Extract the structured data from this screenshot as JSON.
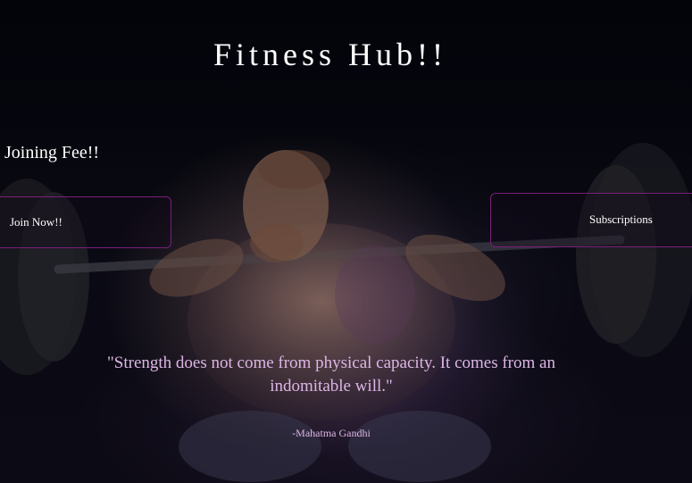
{
  "header": {
    "title": "Fitness Hub!!"
  },
  "pricing": {
    "joining_fee_label": "Joining Fee!!",
    "join_button_label": "Join Now!!",
    "subscriptions_button_label": "Subscriptions"
  },
  "quote": {
    "text": "\"Strength does not come from physical capacity. It comes from an indomitable will.\"",
    "author": "-Mahatma Gandhi"
  },
  "colors": {
    "background": "#05060c",
    "text": "#ffffff",
    "quote_text": "#dcb6e6",
    "button_border": "#7a1f7a"
  },
  "background_image": {
    "icon": "weightlifter-background-image"
  }
}
